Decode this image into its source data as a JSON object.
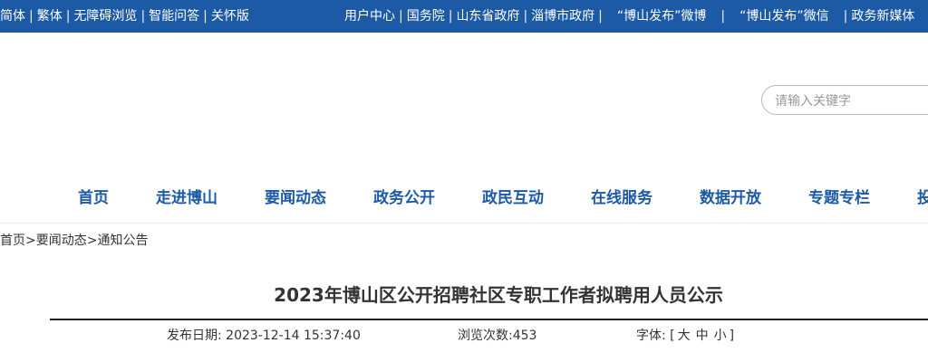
{
  "topbar": {
    "left_links": [
      "简体",
      "繁体",
      "无障碍浏览",
      "智能问答",
      "关怀版"
    ],
    "right_links": [
      "用户中心",
      "国务院",
      "山东省政府",
      "淄博市政府",
      "“博山发布”微博",
      "“博山发布”微信",
      "政务新媒体"
    ]
  },
  "search": {
    "placeholder": "请输入关键字"
  },
  "nav": {
    "items": [
      "首页",
      "走进博山",
      "要闻动态",
      "政务公开",
      "政民互动",
      "在线服务",
      "数据开放",
      "专题专栏",
      "投资博山"
    ]
  },
  "breadcrumb": {
    "home": "首页",
    "sep": ">",
    "level1": "要闻动态",
    "level2": "通知公告"
  },
  "article": {
    "title": "2023年博山区公开招聘社区专职工作者拟聘用人员公示",
    "publish_label": "发布日期:",
    "publish_date": "2023-12-14 15:37:40",
    "views_label": "浏览次数:",
    "views_count": "453",
    "font_label": "字体:",
    "font_open": "[",
    "font_large": "大",
    "font_medium": "中",
    "font_small": "小",
    "font_close": "]"
  },
  "colors": {
    "topbar": "#1c5aa6",
    "nav_text": "#1c5aa6"
  }
}
